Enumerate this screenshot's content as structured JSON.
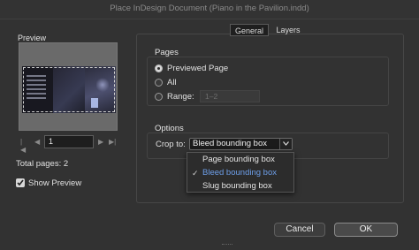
{
  "window": {
    "title": "Place InDesign Document (Piano in the Pavilion.indd)"
  },
  "preview": {
    "label": "Preview",
    "page_number": "1",
    "total_pages_label": "Total pages: 2",
    "show_preview_label": "Show Preview",
    "show_preview_checked": true
  },
  "tabs": [
    {
      "label": "General",
      "active": true
    },
    {
      "label": "Layers",
      "active": false
    }
  ],
  "pages": {
    "title": "Pages",
    "options": [
      {
        "label": "Previewed Page",
        "checked": true
      },
      {
        "label": "All",
        "checked": false
      },
      {
        "label": "Range:",
        "checked": false
      }
    ],
    "range_value": "1–2"
  },
  "options": {
    "title": "Options",
    "crop_label": "Crop to:",
    "crop_value": "Bleed bounding box",
    "crop_options": [
      {
        "label": "Page bounding box",
        "selected": false
      },
      {
        "label": "Bleed bounding box",
        "selected": true
      },
      {
        "label": "Slug bounding box",
        "selected": false
      }
    ]
  },
  "buttons": {
    "cancel": "Cancel",
    "ok": "OK"
  },
  "icons": {
    "first_page": "first-page-icon",
    "prev_page": "previous-page-icon",
    "next_page": "next-page-icon",
    "last_page": "last-page-icon",
    "checkmark": "checkmark-icon",
    "chevron": "chevron-down-icon"
  },
  "colors": {
    "selected_item": "#6d9ee8",
    "dialog_bg": "#323232"
  }
}
